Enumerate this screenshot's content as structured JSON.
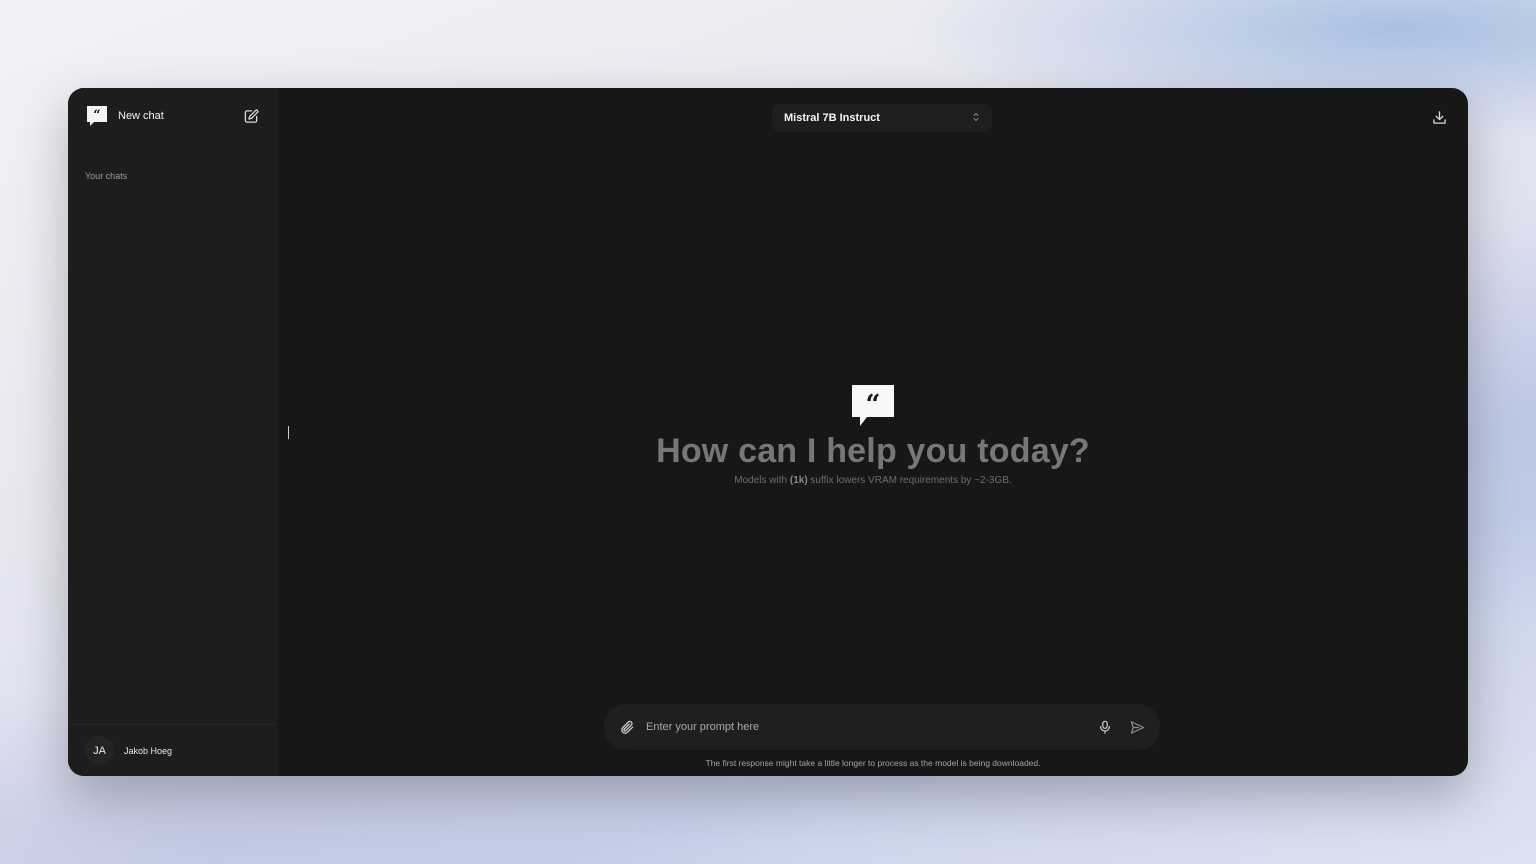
{
  "sidebar": {
    "new_chat_label": "New chat",
    "section_label": "Your chats",
    "user": {
      "initials": "JA",
      "name": "Jakob Hoeg"
    }
  },
  "header": {
    "model_selected": "Mistral 7B Instruct"
  },
  "hero": {
    "title": "How can I help you today?",
    "subtitle_prefix": "Models with ",
    "subtitle_bold": "(1k)",
    "subtitle_suffix": " suffix lowers VRAM requirements by ~2-3GB."
  },
  "composer": {
    "placeholder": "Enter your prompt here",
    "value": ""
  },
  "footer_hint": "The first response might take a little longer to process as the model is being downloaded.",
  "icons": {
    "brand": "quote-bubble-icon",
    "new_chat": "edit-icon",
    "model_select": "chevron-up-down-icon",
    "download": "download-icon",
    "attach": "paperclip-icon",
    "mic": "microphone-icon",
    "send": "send-icon"
  },
  "colors": {
    "window_bg": "#171717",
    "sidebar_bg": "#1d1d1d",
    "title_text": "#777777"
  }
}
